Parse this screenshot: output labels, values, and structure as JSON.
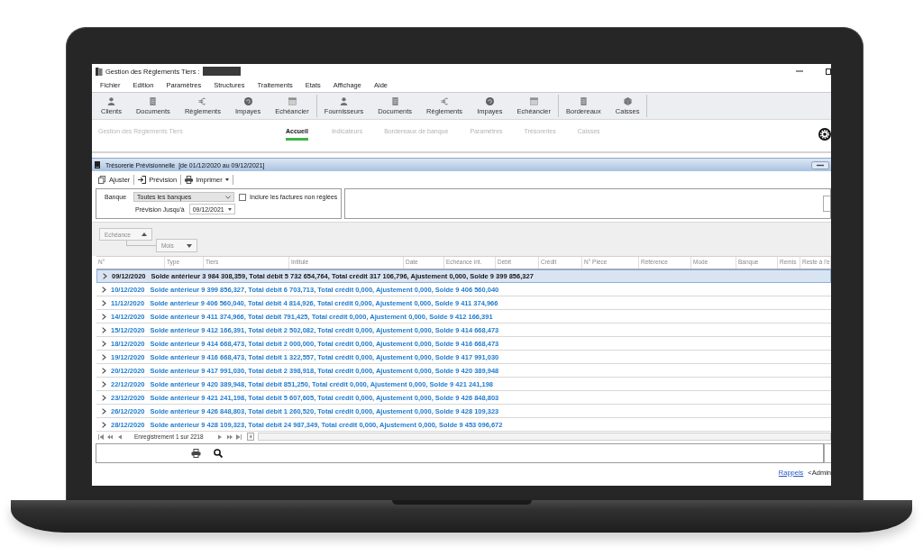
{
  "window": {
    "title": "Gestion des Règlements Tiers :",
    "redacted": true
  },
  "menu": [
    "Fichier",
    "Edition",
    "Paramètres",
    "Structures",
    "Traitements",
    "Etats",
    "Affichage",
    "Aide"
  ],
  "toolbar": {
    "groups": [
      {
        "items": [
          {
            "label": "Clients",
            "kind": "person"
          },
          {
            "label": "Documents",
            "kind": "document"
          },
          {
            "label": "Règlements",
            "kind": "euro"
          },
          {
            "label": "Impayes",
            "kind": "disc"
          },
          {
            "label": "Echéancier",
            "kind": "calendar"
          }
        ]
      },
      {
        "items": [
          {
            "label": "Fournisseurs",
            "kind": "person"
          },
          {
            "label": "Documents",
            "kind": "document"
          },
          {
            "label": "Règlements",
            "kind": "euro"
          },
          {
            "label": "Impayes",
            "kind": "disc"
          },
          {
            "label": "Echéancier",
            "kind": "calendar"
          }
        ]
      },
      {
        "items": [
          {
            "label": "Bordereaux",
            "kind": "document"
          },
          {
            "label": "Caisses",
            "kind": "cube"
          }
        ]
      }
    ]
  },
  "nav": {
    "app_name": "Gestion des Règlements Tiers",
    "tabs": [
      {
        "label": "Accueil",
        "selected": true
      },
      {
        "label": "Indicateurs",
        "selected": false
      },
      {
        "label": "Bordereaux de banque",
        "selected": false
      },
      {
        "label": "Paramètres",
        "selected": false
      },
      {
        "label": "Trésoreries",
        "selected": false
      },
      {
        "label": "Caisses",
        "selected": false
      }
    ]
  },
  "panel": {
    "title": "Trésorerie Prévisionnelle",
    "period": "[de 01/12/2020 au 09/12/2021]",
    "actions": [
      {
        "label": "Ajuster",
        "kind": "adjust",
        "has_menu": false
      },
      {
        "label": "Prévision",
        "kind": "forecast",
        "has_menu": false
      },
      {
        "label": "Imprimer",
        "kind": "print",
        "has_menu": true
      }
    ]
  },
  "filters": {
    "bank": {
      "label": "Banque",
      "value": "Toutes les banques"
    },
    "include_unpaid": {
      "label": "Inclure les factures non réglées",
      "checked": false
    },
    "forecast_until": {
      "label": "Prévision Jusqu'à",
      "value": "09/12/2021"
    }
  },
  "grouping": [
    {
      "label": "Echéance",
      "ascending": true
    },
    {
      "label": "Mois",
      "ascending": false
    }
  ],
  "table": {
    "columns": [
      "N°",
      "Type",
      "Tiers",
      "Intitulé",
      "Date",
      "Echéance int.",
      "Débit",
      "Crédit",
      "N° Pièce",
      "Référence",
      "Mode",
      "Banque",
      "Remis",
      "Reste à l'e"
    ],
    "rows": [
      {
        "date": "09/12/2020",
        "summary": "Solde antérieur 3 984 308,359, Total débit 5 732 654,764, Total crédit 317 106,796, Ajustement 0,000, Solde 9 399 856,327",
        "selected": true,
        "expanded": false
      },
      {
        "date": "10/12/2020",
        "summary": "Solde antérieur 9 399 856,327, Total débit 6 703,713, Total crédit 0,000, Ajustement 0,000, Solde 9 406 560,040",
        "selected": false,
        "expanded": false
      },
      {
        "date": "11/12/2020",
        "summary": "Solde antérieur 9 406 560,040, Total débit 4 814,926, Total crédit 0,000, Ajustement 0,000, Solde 9 411 374,966",
        "selected": false,
        "expanded": false
      },
      {
        "date": "14/12/2020",
        "summary": "Solde antérieur 9 411 374,966, Total débit 791,425, Total crédit 0,000, Ajustement 0,000, Solde 9 412 166,391",
        "selected": false,
        "expanded": false
      },
      {
        "date": "15/12/2020",
        "summary": "Solde antérieur 9 412 166,391, Total débit 2 502,082, Total crédit 0,000, Ajustement 0,000, Solde 9 414 668,473",
        "selected": false,
        "expanded": false
      },
      {
        "date": "18/12/2020",
        "summary": "Solde antérieur 9 414 668,473, Total débit 2 000,000, Total crédit 0,000, Ajustement 0,000, Solde 9 416 668,473",
        "selected": false,
        "expanded": false
      },
      {
        "date": "19/12/2020",
        "summary": "Solde antérieur 9 416 668,473, Total débit 1 322,557, Total crédit 0,000, Ajustement 0,000, Solde 9 417 991,030",
        "selected": false,
        "expanded": false
      },
      {
        "date": "20/12/2020",
        "summary": "Solde antérieur 9 417 991,030, Total débit 2 398,918, Total crédit 0,000, Ajustement 0,000, Solde 9 420 389,948",
        "selected": false,
        "expanded": false
      },
      {
        "date": "22/12/2020",
        "summary": "Solde antérieur 9 420 389,948, Total débit 851,250, Total crédit 0,000, Ajustement 0,000, Solde 9 421 241,198",
        "selected": false,
        "expanded": false
      },
      {
        "date": "23/12/2020",
        "summary": "Solde antérieur 9 421 241,198, Total débit 5 607,605, Total crédit 0,000, Ajustement 0,000, Solde 9 426 848,803",
        "selected": false,
        "expanded": false
      },
      {
        "date": "26/12/2020",
        "summary": "Solde antérieur 9 426 848,803, Total débit 1 260,520, Total crédit 0,000, Ajustement 0,000, Solde 9 428 109,323",
        "selected": false,
        "expanded": false
      },
      {
        "date": "28/12/2020",
        "summary": "Solde antérieur 9 428 109,323, Total débit 24 987,349, Total crédit 0,000, Ajustement 0,000, Solde 9 453 096,672",
        "selected": false,
        "expanded": false
      }
    ]
  },
  "navigator": {
    "record": "Enregistrement 1 sur 2218"
  },
  "status_bar": {
    "link": "Rappels",
    "user": "<Admin"
  }
}
